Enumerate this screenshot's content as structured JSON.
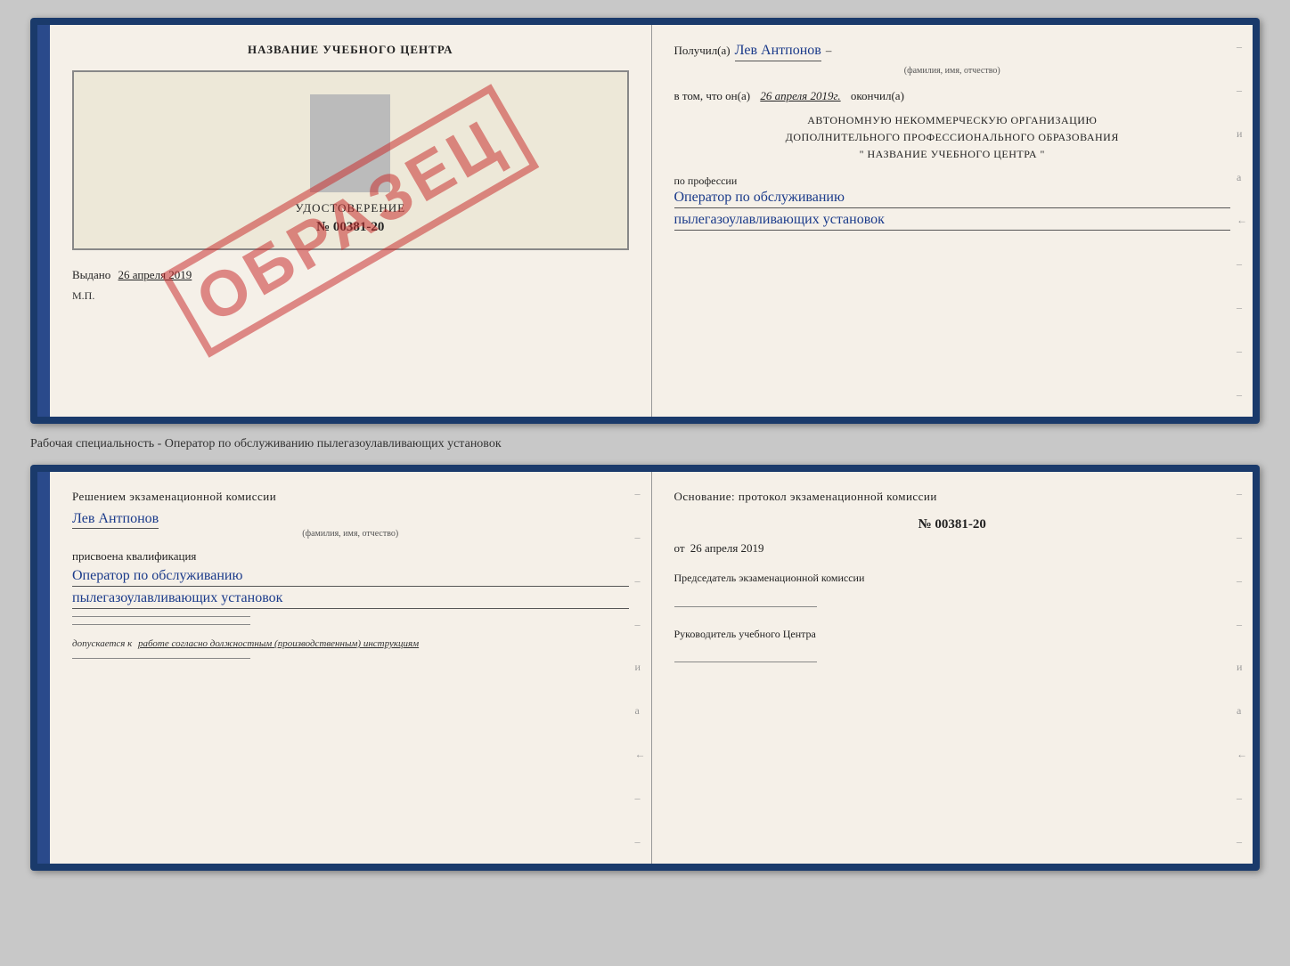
{
  "top_document": {
    "left": {
      "title": "НАЗВАНИЕ УЧЕБНОГО ЦЕНТРА",
      "cert_label": "УДОСТОВЕРЕНИЕ",
      "cert_number": "№ 00381-20",
      "issued_text": "Выдано",
      "issued_date": "26 апреля 2019",
      "mp": "М.П.",
      "watermark": "ОБРАЗЕЦ"
    },
    "right": {
      "received_label": "Получил(а)",
      "recipient_name": "Лев Антпонов",
      "fio_label": "(фамилия, имя, отчество)",
      "completed_prefix": "в том, что он(а)",
      "completed_date": "26 апреля 2019г.",
      "completed_suffix": "окончил(а)",
      "org_line1": "АВТОНОМНУЮ НЕКОММЕРЧЕСКУЮ ОРГАНИЗАЦИЮ",
      "org_line2": "ДОПОЛНИТЕЛЬНОГО ПРОФЕССИОНАЛЬНОГО ОБРАЗОВАНИЯ",
      "org_line3": "\"  НАЗВАНИЕ УЧЕБНОГО ЦЕНТРА  \"",
      "profession_label": "по профессии",
      "profession_line1": "Оператор по обслуживанию",
      "profession_line2": "пылегазоулавливающих установок"
    }
  },
  "middle_label": "Рабочая специальность - Оператор по обслуживанию пылегазоулавливающих установок",
  "bottom_document": {
    "left": {
      "decision_title": "Решением экзаменационной комиссии",
      "person_name": "Лев Антпонов",
      "fio_label": "(фамилия, имя, отчество)",
      "qualification_label": "присвоена квалификация",
      "qualification_line1": "Оператор по обслуживанию",
      "qualification_line2": "пылегазоулавливающих установок",
      "allowed_prefix": "допускается к",
      "allowed_text": "работе согласно должностным (производственным) инструкциям"
    },
    "right": {
      "basis_label": "Основание: протокол экзаменационной комиссии",
      "protocol_number": "№ 00381-20",
      "date_prefix": "от",
      "date_value": "26 апреля 2019",
      "chairman_label": "Председатель экзаменационной комиссии",
      "director_label": "Руководитель учебного Центра"
    }
  }
}
